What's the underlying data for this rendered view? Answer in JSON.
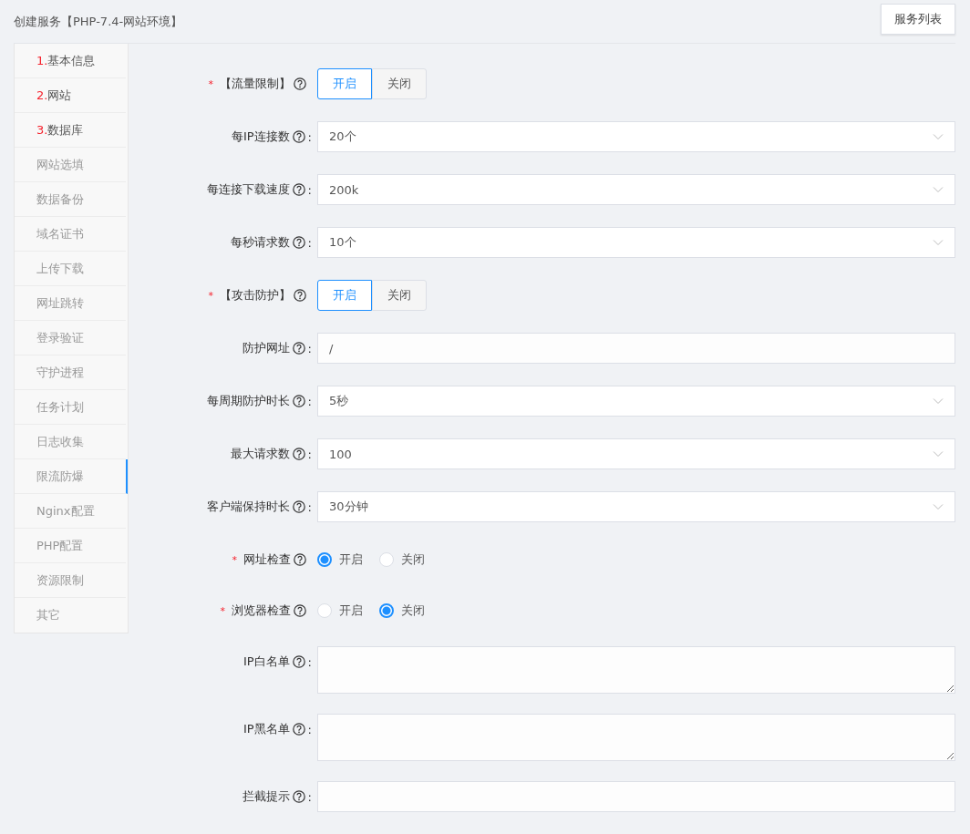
{
  "header": {
    "title": "创建服务【PHP-7.4-网站环境】",
    "button": "服务列表"
  },
  "sidebar": {
    "items": [
      {
        "number": "1.",
        "label": "基本信息",
        "required": true,
        "selected": false
      },
      {
        "number": "2.",
        "label": "网站",
        "required": true,
        "selected": false
      },
      {
        "number": "3.",
        "label": "数据库",
        "required": true,
        "selected": false
      },
      {
        "label": "网站选填",
        "required": false,
        "selected": false
      },
      {
        "label": "数据备份",
        "required": false,
        "selected": false
      },
      {
        "label": "域名证书",
        "required": false,
        "selected": false
      },
      {
        "label": "上传下载",
        "required": false,
        "selected": false
      },
      {
        "label": "网址跳转",
        "required": false,
        "selected": false
      },
      {
        "label": "登录验证",
        "required": false,
        "selected": false
      },
      {
        "label": "守护进程",
        "required": false,
        "selected": false
      },
      {
        "label": "任务计划",
        "required": false,
        "selected": false
      },
      {
        "label": "日志收集",
        "required": false,
        "selected": false
      },
      {
        "label": "限流防爆",
        "required": false,
        "selected": true
      },
      {
        "label": "Nginx配置",
        "required": false,
        "selected": false
      },
      {
        "label": "PHP配置",
        "required": false,
        "selected": false
      },
      {
        "label": "资源限制",
        "required": false,
        "selected": false
      },
      {
        "label": "其它",
        "required": false,
        "selected": false
      }
    ]
  },
  "form": {
    "fields": [
      {
        "kind": "toggle",
        "required_mark": "*",
        "label": "【流量限制】",
        "options": [
          {
            "label": "开启",
            "selected": true
          },
          {
            "label": "关闭",
            "selected": false
          }
        ]
      },
      {
        "kind": "select",
        "label": "每IP连接数",
        "colon": ":",
        "value": "20个"
      },
      {
        "kind": "select",
        "label": "每连接下载速度",
        "colon": ":",
        "value": "200k"
      },
      {
        "kind": "select",
        "label": "每秒请求数",
        "colon": ":",
        "value": "10个"
      },
      {
        "kind": "toggle",
        "required_mark": "*",
        "label": "【攻击防护】",
        "options": [
          {
            "label": "开启",
            "selected": true
          },
          {
            "label": "关闭",
            "selected": false
          }
        ]
      },
      {
        "kind": "input",
        "label": "防护网址",
        "colon": ":",
        "value": "/"
      },
      {
        "kind": "select",
        "label": "每周期防护时长",
        "colon": ":",
        "value": "5秒"
      },
      {
        "kind": "select",
        "label": "最大请求数",
        "colon": ":",
        "value": "100"
      },
      {
        "kind": "select",
        "label": "客户端保持时长",
        "colon": ":",
        "value": "30分钟"
      },
      {
        "kind": "radio",
        "required_mark": "*",
        "label": "网址检查",
        "options": [
          {
            "label": "开启",
            "selected": true
          },
          {
            "label": "关闭",
            "selected": false
          }
        ]
      },
      {
        "kind": "radio",
        "required_mark": "*",
        "label": "浏览器检查",
        "options": [
          {
            "label": "开启",
            "selected": false
          },
          {
            "label": "关闭",
            "selected": true
          }
        ]
      },
      {
        "kind": "textarea",
        "label": "IP白名单",
        "colon": ":"
      },
      {
        "kind": "textarea",
        "label": "IP黑名单",
        "colon": ":"
      },
      {
        "kind": "input",
        "label": "拦截提示",
        "colon": ":"
      }
    ]
  }
}
